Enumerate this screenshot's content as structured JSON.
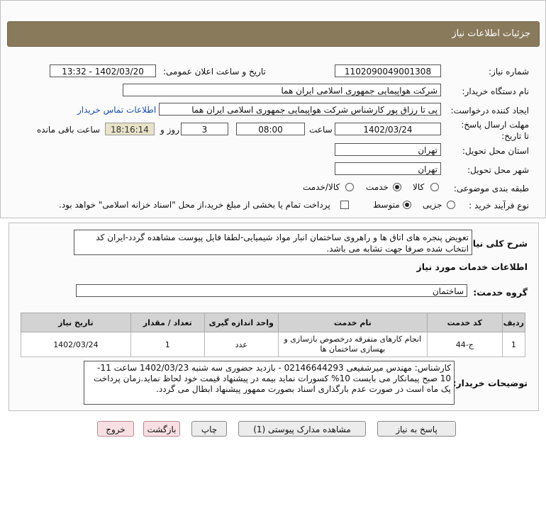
{
  "header": {
    "title": "جزئیات اطلاعات نیاز"
  },
  "fields": {
    "need_number_label": "شماره نیاز:",
    "need_number": "1102090049001308",
    "announce_label": "تاریخ و ساعت اعلان عمومی:",
    "announce_value": "1402/03/20 - 13:32",
    "buyer_org_label": "نام دستگاه خریدار:",
    "buyer_org": "شرکت هواپیمایی جمهوری اسلامی ایران هما",
    "creator_label": "ایجاد کننده درخواست:",
    "creator": "پی تا رزاق پور کارشناس شرکت هواپیمایی جمهوری اسلامی ایران هما",
    "contact_link": "اطلاعات تماس خریدار",
    "deadline_label": "مهلت ارسال پاسخ: تا تاریخ:",
    "deadline_date": "1402/03/24",
    "hour_label": "ساعت",
    "deadline_time": "08:00",
    "days_value": "3",
    "days_label": "روز و",
    "remaining_time": "18:16:14",
    "remaining_label": "ساعت باقی مانده",
    "province_label": "استان محل تحویل:",
    "province": "تهران",
    "city_label": "شهر محل تحویل:",
    "city": "تهران",
    "category_label": "طبقه بندی موضوعی:",
    "category_options": [
      "کالا",
      "خدمت",
      "کالا/خدمت"
    ],
    "process_label": "نوع فرآیند خرید :",
    "process_options": [
      "جزیی",
      "متوسط"
    ],
    "payment_note": "پرداخت تمام یا بخشی از مبلغ خرید،از محل \"اسناد خزانه اسلامی\" خواهد بود."
  },
  "details": {
    "summary_label": "شرح کلی نیاز:",
    "summary": "تعویض پنجره های اتاق ها و راهروی ساختمان انبار مواد شیمیایی-لطفا فایل پیوست مشاهده گردد-ایران کد انتخاب شده صرفا جهت تشابه می باشد.",
    "services_heading": "اطلاعات خدمات مورد نیاز",
    "service_group_label": "گروه خدمت:",
    "service_group": "ساختمان",
    "table_headers": [
      "ردیف",
      "کد خدمت",
      "نام خدمت",
      "واحد اندازه گیری",
      "تعداد / مقدار",
      "تاریخ نیاز"
    ],
    "rows": [
      {
        "row": "1",
        "code": "ج-44",
        "name": "انجام کارهای متفرقه درخصوص بازسازی و بهسازی ساختمان ها",
        "unit": "عدد",
        "qty": "1",
        "date": "1402/03/24"
      }
    ],
    "buyer_notes_label": "توضیحات خریدار:",
    "buyer_notes": "کارشناس: مهندس میرشفیعی 02146644293 - بازدید حضوری سه شنبه 1402/03/23 ساعت 11-10 صبح پیمانکار می بایست 10% کسورات نماید بیمه در پیشنهاد قیمت خود لحاظ نماید.زمان پرداخت یک ماه است در صورت عدم بارگذاری اسناد بصورت ممهور پیشنهاد ابطال می گردد."
  },
  "buttons": {
    "reply": "پاسخ به نیاز",
    "attachments": "مشاهده مدارک پیوستی (1)",
    "print": "چاپ",
    "back": "بازگشت",
    "exit": "خروج"
  },
  "colors": {
    "header_bg": "#8a7a5c",
    "link": "#1a4fb3",
    "exit_btn": "#f7dfe3"
  }
}
